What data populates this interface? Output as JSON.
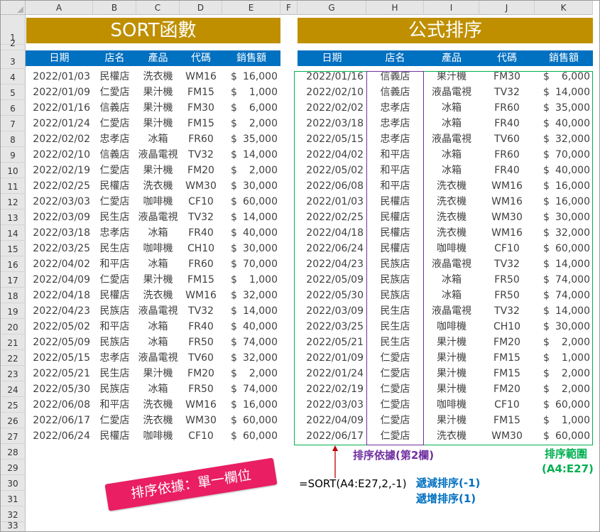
{
  "columns": [
    "A",
    "B",
    "C",
    "D",
    "E",
    "F",
    "G",
    "H",
    "I",
    "J",
    "K"
  ],
  "rows": [
    "1",
    "2",
    "3",
    "4",
    "5",
    "6",
    "7",
    "8",
    "9",
    "10",
    "11",
    "12",
    "13",
    "14",
    "15",
    "16",
    "17",
    "18",
    "19",
    "20",
    "21",
    "22",
    "23",
    "24",
    "25",
    "26",
    "27",
    "28",
    "29",
    "30",
    "31",
    "32",
    "33"
  ],
  "left_title": "SORT函數",
  "right_title": "公式排序",
  "headers": [
    "日期",
    "店名",
    "產品",
    "代碼",
    "銷售額"
  ],
  "currency": "$",
  "left_rows": [
    [
      "2022/01/03",
      "民權店",
      "洗衣機",
      "WM16",
      "16,000"
    ],
    [
      "2022/01/09",
      "仁愛店",
      "果汁機",
      "FM15",
      "1,000"
    ],
    [
      "2022/01/16",
      "信義店",
      "果汁機",
      "FM30",
      "6,000"
    ],
    [
      "2022/01/24",
      "仁愛店",
      "果汁機",
      "FM15",
      "2,000"
    ],
    [
      "2022/02/02",
      "忠孝店",
      "冰箱",
      "FR60",
      "35,000"
    ],
    [
      "2022/02/10",
      "信義店",
      "液晶電視",
      "TV32",
      "14,000"
    ],
    [
      "2022/02/19",
      "仁愛店",
      "果汁機",
      "FM20",
      "2,000"
    ],
    [
      "2022/02/25",
      "民權店",
      "洗衣機",
      "WM30",
      "30,000"
    ],
    [
      "2022/03/03",
      "仁愛店",
      "咖啡機",
      "CF10",
      "60,000"
    ],
    [
      "2022/03/09",
      "民生店",
      "液晶電視",
      "TV32",
      "14,000"
    ],
    [
      "2022/03/18",
      "忠孝店",
      "冰箱",
      "FR40",
      "40,000"
    ],
    [
      "2022/03/25",
      "民生店",
      "咖啡機",
      "CH10",
      "30,000"
    ],
    [
      "2022/04/02",
      "和平店",
      "冰箱",
      "FR60",
      "70,000"
    ],
    [
      "2022/04/09",
      "仁愛店",
      "果汁機",
      "FM15",
      "1,000"
    ],
    [
      "2022/04/18",
      "民權店",
      "洗衣機",
      "WM16",
      "32,000"
    ],
    [
      "2022/04/23",
      "民族店",
      "液晶電視",
      "TV32",
      "14,000"
    ],
    [
      "2022/05/02",
      "和平店",
      "冰箱",
      "FR40",
      "40,000"
    ],
    [
      "2022/05/09",
      "民族店",
      "冰箱",
      "FR50",
      "74,000"
    ],
    [
      "2022/05/15",
      "忠孝店",
      "液晶電視",
      "TV60",
      "32,000"
    ],
    [
      "2022/05/21",
      "民生店",
      "果汁機",
      "FM20",
      "2,000"
    ],
    [
      "2022/05/30",
      "民族店",
      "冰箱",
      "FR50",
      "74,000"
    ],
    [
      "2022/06/08",
      "和平店",
      "洗衣機",
      "WM16",
      "16,000"
    ],
    [
      "2022/06/17",
      "仁愛店",
      "洗衣機",
      "WM30",
      "60,000"
    ],
    [
      "2022/06/24",
      "民權店",
      "咖啡機",
      "CF10",
      "60,000"
    ]
  ],
  "right_rows": [
    [
      "2022/01/16",
      "信義店",
      "果汁機",
      "FM30",
      "6,000"
    ],
    [
      "2022/02/10",
      "信義店",
      "液晶電視",
      "TV32",
      "14,000"
    ],
    [
      "2022/02/02",
      "忠孝店",
      "冰箱",
      "FR60",
      "35,000"
    ],
    [
      "2022/03/18",
      "忠孝店",
      "冰箱",
      "FR40",
      "40,000"
    ],
    [
      "2022/05/15",
      "忠孝店",
      "液晶電視",
      "TV60",
      "32,000"
    ],
    [
      "2022/04/02",
      "和平店",
      "冰箱",
      "FR60",
      "70,000"
    ],
    [
      "2022/05/02",
      "和平店",
      "冰箱",
      "FR40",
      "40,000"
    ],
    [
      "2022/06/08",
      "和平店",
      "洗衣機",
      "WM16",
      "16,000"
    ],
    [
      "2022/01/03",
      "民權店",
      "洗衣機",
      "WM16",
      "16,000"
    ],
    [
      "2022/02/25",
      "民權店",
      "洗衣機",
      "WM30",
      "30,000"
    ],
    [
      "2022/04/18",
      "民權店",
      "洗衣機",
      "WM16",
      "32,000"
    ],
    [
      "2022/06/24",
      "民權店",
      "咖啡機",
      "CF10",
      "60,000"
    ],
    [
      "2022/04/23",
      "民族店",
      "液晶電視",
      "TV32",
      "14,000"
    ],
    [
      "2022/05/09",
      "民族店",
      "冰箱",
      "FR50",
      "74,000"
    ],
    [
      "2022/05/30",
      "民族店",
      "冰箱",
      "FR50",
      "74,000"
    ],
    [
      "2022/03/09",
      "民生店",
      "液晶電視",
      "TV32",
      "14,000"
    ],
    [
      "2022/03/25",
      "民生店",
      "咖啡機",
      "CH10",
      "30,000"
    ],
    [
      "2022/05/21",
      "民生店",
      "果汁機",
      "FM20",
      "2,000"
    ],
    [
      "2022/01/09",
      "仁愛店",
      "果汁機",
      "FM15",
      "1,000"
    ],
    [
      "2022/01/24",
      "仁愛店",
      "果汁機",
      "FM15",
      "2,000"
    ],
    [
      "2022/02/19",
      "仁愛店",
      "果汁機",
      "FM20",
      "2,000"
    ],
    [
      "2022/03/03",
      "仁愛店",
      "咖啡機",
      "CF10",
      "60,000"
    ],
    [
      "2022/04/09",
      "仁愛店",
      "果汁機",
      "FM15",
      "1,000"
    ],
    [
      "2022/06/17",
      "仁愛店",
      "洗衣機",
      "WM30",
      "60,000"
    ]
  ],
  "annotations": {
    "sort_key": "排序依據(第2欄)",
    "sort_range_1": "排序範圍",
    "sort_range_2": "(A4:E27)",
    "formula": "=SORT(A4:E27,2,-1)",
    "desc": "遞減排序(-1)",
    "asc": "遞增排序(1)",
    "stamp": "排序依據：單一欄位"
  },
  "colors": {
    "banner": "#bf8f00",
    "header": "#0070c0",
    "range_box": "#00b050",
    "key_box": "#7030a0",
    "arrow": "#c00000",
    "order_text": "#0070c0",
    "stamp": "#e91e63"
  }
}
